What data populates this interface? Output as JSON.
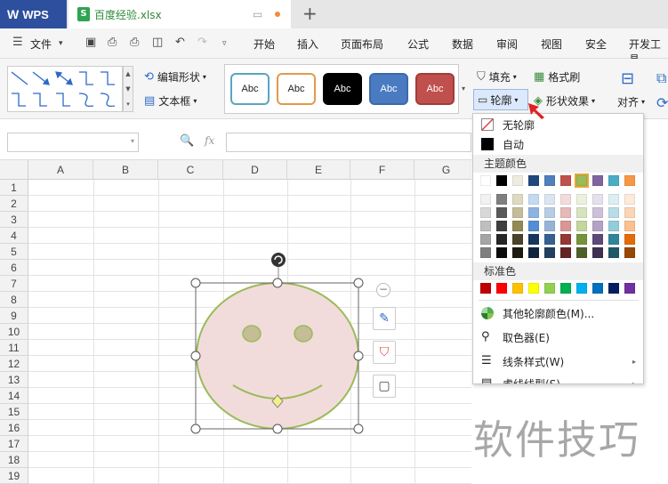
{
  "titlebar": {
    "app_name": "WPS",
    "doc_tab_label": "百度经验.xlsx",
    "new_tab": "+"
  },
  "menubar": {
    "file_label": "文件",
    "tabs": [
      "开始",
      "插入",
      "页面布局",
      "公式",
      "数据",
      "审阅",
      "视图",
      "安全",
      "开发工具"
    ]
  },
  "ribbon": {
    "edit_shape": "编辑形状",
    "text_box": "文本框",
    "style_swatch_label": "Abc",
    "fill_label": "填充",
    "format_painter": "格式刷",
    "outline_label": "轮廓",
    "shape_effect": "形状效果",
    "align_label": "对齐",
    "swatch_colors": [
      {
        "bg": "#ffffff",
        "border": "#5aa5c2",
        "text": "#222222"
      },
      {
        "bg": "#ffffff",
        "border": "#e29a4a",
        "text": "#222222"
      },
      {
        "bg": "#000000",
        "border": "#000000",
        "text": "#ffffff"
      },
      {
        "bg": "#4a7bc1",
        "border": "#3a6aaa",
        "text": "#ffffff"
      },
      {
        "bg": "#c0504d",
        "border": "#a03c3a",
        "text": "#ffffff"
      }
    ]
  },
  "formula_bar": {
    "fx": "fx"
  },
  "sheet": {
    "columns": [
      "A",
      "B",
      "C",
      "D",
      "E",
      "F",
      "G"
    ],
    "rows": [
      "1",
      "2",
      "3",
      "4",
      "5",
      "6",
      "7",
      "8",
      "9",
      "10",
      "11",
      "12",
      "13",
      "14",
      "15",
      "16",
      "17",
      "18",
      "19"
    ]
  },
  "smiley": {
    "face_fill": "#f2dcdb",
    "outline": "#9bbb59",
    "eye_fill": "#c4bd97",
    "mouth": "#9bbb59"
  },
  "outline_menu": {
    "no_outline": "无轮廓",
    "automatic": "自动",
    "theme_colors_header": "主题颜色",
    "standard_colors_header": "标准色",
    "more_colors": "其他轮廓颜色(M)...",
    "eyedropper": "取色器(E)",
    "line_style": "线条样式(W)",
    "dash_type": "虚线线型(S)",
    "theme_top_row": [
      "#ffffff",
      "#000000",
      "#eeece1",
      "#1f497d",
      "#4f81bd",
      "#c0504d",
      "#9bbb59",
      "#8064a2",
      "#4bacc6",
      "#f79646"
    ],
    "theme_shades": [
      [
        "#f2f2f2",
        "#7f7f7f",
        "#ddd9c3",
        "#c6d9f0",
        "#dbe5f1",
        "#f2dcdb",
        "#ebf1dd",
        "#e5e0ec",
        "#dbeef3",
        "#fdeada"
      ],
      [
        "#d8d8d8",
        "#595959",
        "#c4bd97",
        "#8db3e2",
        "#b8cce4",
        "#e5b9b7",
        "#d7e3bc",
        "#ccc1d9",
        "#b7dde8",
        "#fbd5b5"
      ],
      [
        "#bfbfbf",
        "#3f3f3f",
        "#938953",
        "#548dd4",
        "#95b3d7",
        "#d99694",
        "#c3d69b",
        "#b2a2c7",
        "#92cddc",
        "#fac08f"
      ],
      [
        "#a5a5a5",
        "#262626",
        "#494429",
        "#17365d",
        "#366092",
        "#953734",
        "#76923c",
        "#5f497a",
        "#31859b",
        "#e36c09"
      ],
      [
        "#7f7f7f",
        "#0c0c0c",
        "#1d1b10",
        "#0f243e",
        "#244061",
        "#632423",
        "#4f6128",
        "#3f3151",
        "#205867",
        "#974806"
      ]
    ],
    "standard_colors": [
      "#c00000",
      "#ff0000",
      "#ffc000",
      "#ffff00",
      "#92d050",
      "#00b050",
      "#00b0f0",
      "#0070c0",
      "#002060",
      "#7030a0"
    ]
  },
  "watermark": "软件技巧"
}
